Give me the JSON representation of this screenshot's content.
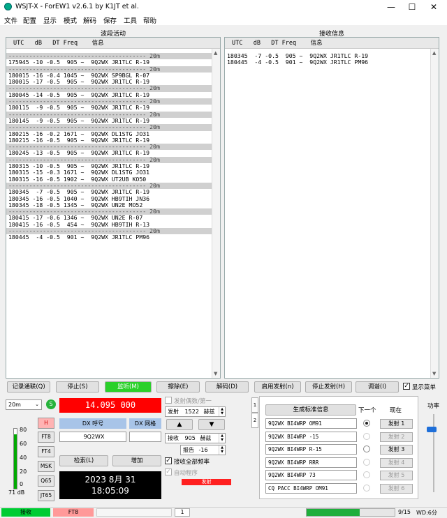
{
  "window": {
    "title": "WSJT-X - ForEW1   v2.6.1   by K1JT et al.",
    "minimize": "—",
    "maximize": "☐",
    "close": "✕"
  },
  "menu": [
    "文件",
    "配置",
    "显示",
    "模式",
    "解码",
    "保存",
    "工具",
    "帮助"
  ],
  "band_activity": {
    "title": "波段活动",
    "header": "UTC   dB   DT Freq    信息",
    "lines": [
      {
        "t": "---------------------------------------- 20m",
        "sep": true
      },
      {
        "t": "175945 -10 -0.5  905 ~  9Q2WX JR1TLC R-19"
      },
      {
        "t": "---------------------------------------- 20m",
        "sep": true
      },
      {
        "t": "180015 -16 -0.4 1045 ~  9Q2WX SP9BGL R-07"
      },
      {
        "t": "180015 -17 -0.5  905 ~  9Q2WX JR1TLC R-19"
      },
      {
        "t": "---------------------------------------- 20m",
        "sep": true
      },
      {
        "t": "180045 -14 -0.5  905 ~  9Q2WX JR1TLC R-19"
      },
      {
        "t": "---------------------------------------- 20m",
        "sep": true
      },
      {
        "t": "180115  -9 -0.5  905 ~  9Q2WX JR1TLC R-19"
      },
      {
        "t": "---------------------------------------- 20m",
        "sep": true
      },
      {
        "t": "180145  -9 -0.5  905 ~  9Q2WX JR1TLC R-19"
      },
      {
        "t": "---------------------------------------- 20m",
        "sep": true
      },
      {
        "t": "180215 -16 -0.2 1671 ~  9Q2WX DL1STG JO31"
      },
      {
        "t": "180215 -16 -0.5  905 ~  9Q2WX JR1TLC R-19"
      },
      {
        "t": "---------------------------------------- 20m",
        "sep": true
      },
      {
        "t": "180245 -13 -0.5  905 ~  9Q2WX JR1TLC R-19"
      },
      {
        "t": "---------------------------------------- 20m",
        "sep": true
      },
      {
        "t": "180315 -10 -0.5  905 ~  9Q2WX JR1TLC R-19"
      },
      {
        "t": "180315 -15 -0.3 1671 ~  9Q2WX DL1STG JO31"
      },
      {
        "t": "180315 -16 -0.5 1902 ~  9Q2WX UT2UB KO50"
      },
      {
        "t": "---------------------------------------- 20m",
        "sep": true
      },
      {
        "t": "180345  -7 -0.5  905 ~  9Q2WX JR1TLC R-19"
      },
      {
        "t": "180345 -16 -0.5 1040 ~  9Q2WX HB9TIH JN36"
      },
      {
        "t": "180345 -18 -0.5 1345 ~  9Q2WX UN2E MO52"
      },
      {
        "t": "---------------------------------------- 20m",
        "sep": true
      },
      {
        "t": "180415 -17 -0.6 1346 ~  9Q2WX UN2E R-07"
      },
      {
        "t": "180415 -16 -0.5  454 ~  9Q2WX HB9TIH R-13"
      },
      {
        "t": "---------------------------------------- 20m",
        "sep": true
      },
      {
        "t": "180445  -4 -0.5  901 ~  9Q2WX JR1TLC PM96"
      }
    ]
  },
  "rx_freq": {
    "title": "接收信息",
    "header": "UTC   dB   DT Freq    信息",
    "lines": [
      {
        "t": "180345  -7 -0.5  905 ~  9Q2WX JR1TLC R-19"
      },
      {
        "t": "180445  -4 -0.5  901 ~  9Q2WX JR1TLC PM96"
      }
    ]
  },
  "buttons": {
    "log_qso": "记录通联(Q)",
    "stop": "停止(S)",
    "monitor": "监听(M)",
    "erase": "擦除(E)",
    "decode": "解码(D)",
    "enable_tx": "启用发射(n)",
    "halt_tx": "停止发射(H)",
    "tune": "调谐(I)",
    "menus": "显示菜单"
  },
  "band": "20m",
  "frequency": "14.095  000",
  "options": {
    "tx_even": "发射偶数/第一",
    "tx_label": "发射",
    "tx_freq": "1522",
    "unit": "赫兹",
    "rx_label": "接收",
    "rx_freq": "905",
    "report_label": "报告",
    "report": "-16",
    "auto_seq": "自动程序",
    "call_1st": "接收全部频率"
  },
  "dx": {
    "call_label": "DX 呼号",
    "grid_label": "DX 网格",
    "call": "9Q2WX",
    "grid": "",
    "lookup": "检索(L)",
    "add": "增加"
  },
  "meter": {
    "ticks": [
      "80",
      "60",
      "40",
      "20",
      "0"
    ],
    "db": "71 dB"
  },
  "modes": [
    "H",
    "FT8",
    "FT4",
    "MSK",
    "Q65",
    "JT65"
  ],
  "clock": {
    "date": "2023 8月 31",
    "time": "18:05:09"
  },
  "tx_indicator": "发射",
  "tabs": [
    "1",
    "2"
  ],
  "messages": {
    "gen_button": "生成标准信息",
    "next_label": "下一个",
    "now_label": "现在",
    "rows": [
      {
        "msg": "9Q2WX BI4WRP OM91",
        "tx": "发射 1",
        "active": true
      },
      {
        "msg": "9Q2WX BI4WRP -15",
        "tx": "发射 2",
        "active": false
      },
      {
        "msg": "9Q2WX BI4WRP R-15",
        "tx": "发射 3",
        "active": true
      },
      {
        "msg": "9Q2WX BI4WRP RRR",
        "tx": "发射 4",
        "active": false
      },
      {
        "msg": "9Q2WX BI4WRP 73",
        "tx": "发射 5",
        "active": false
      },
      {
        "msg": "CQ PACC BI4WRP OM91",
        "tx": "发射 6",
        "active": false
      }
    ]
  },
  "power_label": "功率",
  "status": {
    "mode": "接收",
    "submode": "FT8",
    "page": "1",
    "count": "9/15",
    "wd": "WD:6分"
  },
  "colors": {
    "freq_bg": "#ff0000",
    "monitor_bg": "#2ad02a",
    "status_green": "#00cc33",
    "status_pink": "#ff9999",
    "tx_bar": "#ff2020",
    "progress": "#1fae3c"
  },
  "progress": 0.6
}
